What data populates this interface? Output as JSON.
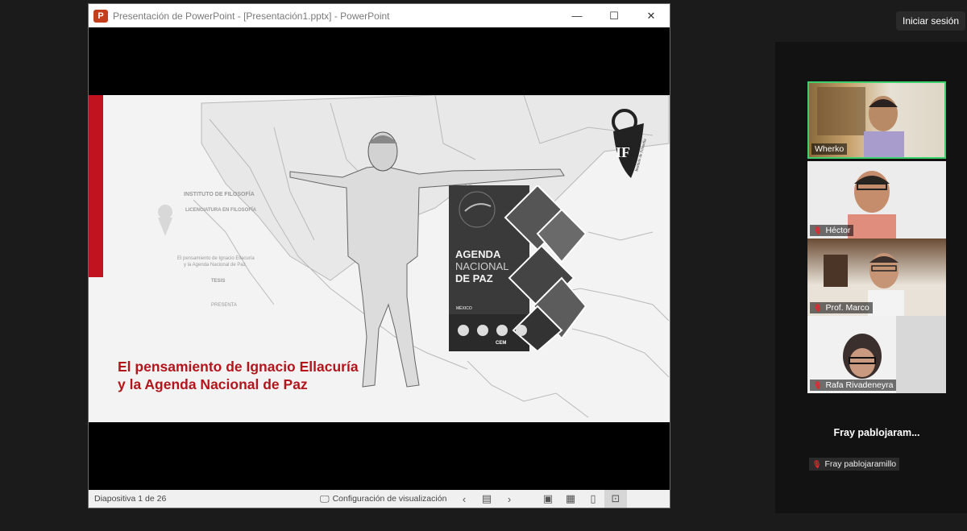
{
  "window": {
    "title": "Presentación de PowerPoint - [Presentación1.pptx] - PowerPoint",
    "app_icon": "P",
    "controls": {
      "minimize": "—",
      "maximize": "☐",
      "close": "✕"
    }
  },
  "slide": {
    "title_line1": "El pensamiento de Ignacio Ellacuría",
    "title_line2": "y la Agenda Nacional de Paz",
    "doc_lines": [
      "INSTITUTO DE FILOSOFÍA",
      "LICENCIATURA EN FILOSOFÍA",
      "El pensamiento de Ignacio Ellacuría",
      "y la Agenda Nacional de Paz",
      "TESIS",
      "PRESENTA"
    ],
    "agenda_line1": "AGENDA",
    "agenda_line2": "NACIONAL",
    "agenda_line3": "DE PAZ",
    "agenda_country": "MÉXICO",
    "agenda_logo": "CEM",
    "logo_letters": "IF",
    "logo_caption": "Instituto de Filosofía",
    "accent_color": "#b3151d"
  },
  "statusbar": {
    "slide_count": "Diapositiva 1 de 26",
    "view_config": "Configuración de visualización",
    "icons": [
      "display-settings-icon",
      "prev-slide-icon",
      "slide-sorter-icon",
      "next-slide-icon",
      "normal-view-icon",
      "grid-view-icon",
      "reading-view-icon",
      "presenter-view-icon"
    ]
  },
  "meeting": {
    "signin": "Iniciar sesión",
    "participants": [
      {
        "name": "Wherko",
        "muted": false,
        "active": true
      },
      {
        "name": "Héctor",
        "muted": true,
        "active": false
      },
      {
        "name": "Prof. Marco",
        "muted": true,
        "active": false
      },
      {
        "name": "Rafa Rivadeneyra",
        "muted": true,
        "active": false
      }
    ],
    "no_video_display": "Fray  pablojaram...",
    "no_video_name": "Fray pablojaramillo"
  }
}
